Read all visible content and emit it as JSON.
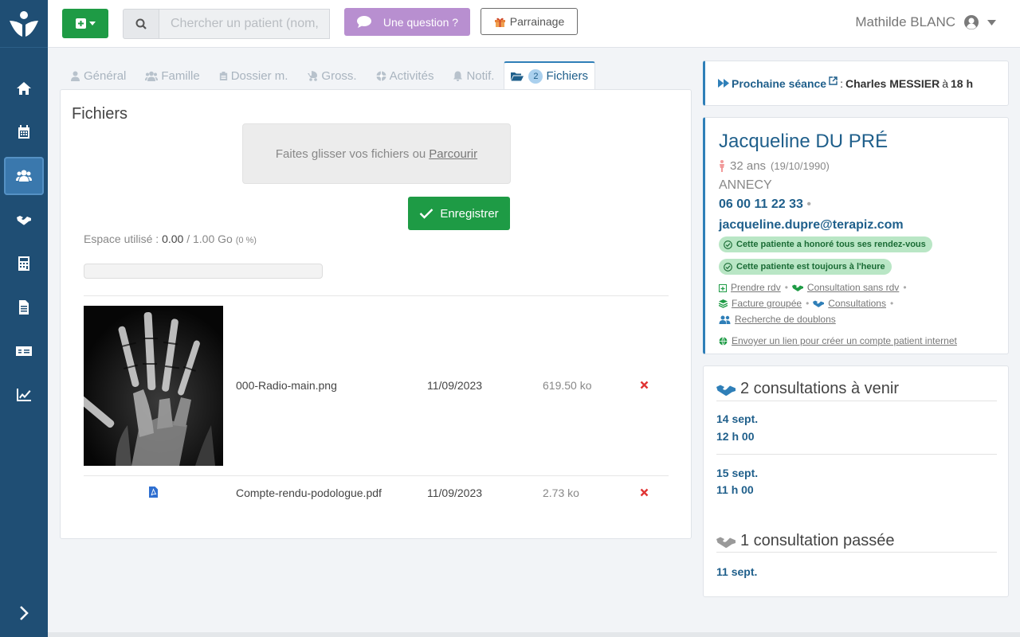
{
  "header": {
    "search_placeholder": "Chercher un patient (nom,",
    "question_label": "Une question ?",
    "parrainage_label": "Parrainage",
    "user_name": "Mathilde BLANC"
  },
  "tabs": [
    {
      "label": "Général",
      "icon": "user-icon"
    },
    {
      "label": "Famille",
      "icon": "users-icon"
    },
    {
      "label": "Dossier m.",
      "icon": "clipboard-icon"
    },
    {
      "label": "Gross.",
      "icon": "baby-carriage-icon"
    },
    {
      "label": "Activités",
      "icon": "ball-icon"
    },
    {
      "label": "Notif.",
      "icon": "bell-icon"
    },
    {
      "label": "Fichiers",
      "icon": "folder-open-icon",
      "badge": "2",
      "active": true
    }
  ],
  "files": {
    "title": "Fichiers",
    "dropzone_text": "Faites glisser vos fichiers ou",
    "dropzone_link": "Parcourir",
    "save_label": "Enregistrer",
    "space_label": "Espace utilisé :",
    "space_used": "0.00",
    "space_total": "/ 1.00 Go",
    "space_pct": "(0 %)",
    "usage_fraction": 0.0,
    "rows": [
      {
        "name": "000-Radio-main.png",
        "date": "11/09/2023",
        "size": "619.50 ko",
        "thumb": "xray-hand-image"
      },
      {
        "name": "Compte-rendu-podologue.pdf",
        "date": "11/09/2023",
        "size": "2.73 ko",
        "thumb": "pdf-icon"
      }
    ]
  },
  "next_session": {
    "label": "Prochaine séance",
    "sep": ":",
    "person": "Charles MESSIER",
    "at": "à",
    "time": "18 h"
  },
  "patient": {
    "name": "Jacqueline DU PRÉ",
    "age": "32 ans",
    "dob": "(19/10/1990)",
    "city": "ANNECY",
    "phone": "06 00 11 22 33",
    "phone_dot": "•",
    "email": "jacqueline.dupre@terapiz.com",
    "badge_honored": "Cette patiente a honoré tous ses rendez-vous",
    "badge_ontime": "Cette patiente est toujours à l'heure",
    "link_rdv": "Prendre rdv",
    "link_consult_sans_rdv": "Consultation sans rdv",
    "link_facture": "Facture groupée",
    "link_consultations": "Consultations",
    "link_doublons": "Recherche de doublons",
    "link_compte": "Envoyer un lien pour créer un compte patient internet",
    "bullet": "•",
    "accent_color": "#1f5f8b",
    "chip_color": "#b9e6c5"
  },
  "consultations": {
    "upcoming_title": "2 consultations à venir",
    "upcoming": [
      {
        "date": "14 sept.",
        "time": "12 h 00"
      },
      {
        "date": "15 sept.",
        "time": "11 h 00"
      }
    ],
    "past_title": "1 consultation passée",
    "past": [
      {
        "date": "11 sept."
      }
    ]
  },
  "sidebar": {
    "items": [
      {
        "name": "home-icon"
      },
      {
        "name": "calendar-icon"
      },
      {
        "name": "patients-icon",
        "active": true
      },
      {
        "name": "handshake-icon"
      },
      {
        "name": "calculator-icon"
      },
      {
        "name": "document-icon"
      },
      {
        "name": "money-card-icon"
      },
      {
        "name": "chart-icon"
      }
    ]
  }
}
